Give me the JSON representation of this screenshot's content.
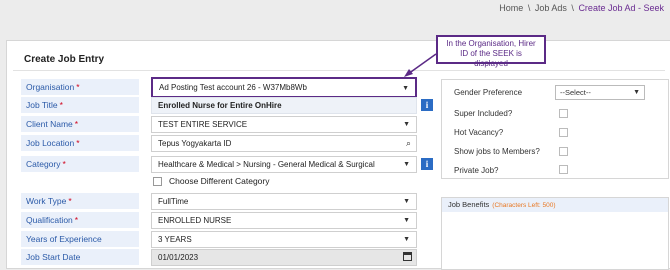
{
  "breadcrumb": {
    "home": "Home",
    "sep": "\\",
    "job_ads": "Job Ads",
    "current": "Create Job Ad - Seek"
  },
  "card": {
    "title": "Create Job Entry"
  },
  "form": {
    "organisation": {
      "label": "Organisation",
      "required": "*",
      "value": "Ad Posting Test account 26 - W37Mb8Wb"
    },
    "job_title": {
      "label": "Job Title",
      "required": "*",
      "value": "Enrolled Nurse for Entire OnHire"
    },
    "client_name": {
      "label": "Client Name",
      "required": "*",
      "value": "TEST ENTIRE SERVICE"
    },
    "job_location": {
      "label": "Job Location",
      "required": "*",
      "value": "Tepus Yogyakarta ID"
    },
    "category": {
      "label": "Category",
      "required": "*",
      "value": "Healthcare & Medical > Nursing - General Medical & Surgical"
    },
    "choose_different_category": "Choose Different Category",
    "work_type": {
      "label": "Work Type",
      "required": "*",
      "value": "FullTime"
    },
    "qualification": {
      "label": "Qualification",
      "required": "*",
      "value": "ENROLLED NURSE"
    },
    "years_experience": {
      "label": "Years of Experience",
      "value": "3 YEARS"
    },
    "job_start_date": {
      "label": "Job Start Date",
      "value": "01/01/2023"
    }
  },
  "right_panel": {
    "gender_preference": {
      "label": "Gender Preference",
      "value": "--Select--"
    },
    "super_included": "Super Included?",
    "hot_vacancy": "Hot Vacancy?",
    "show_jobs": "Show jobs to Members?",
    "private_job": "Private Job?"
  },
  "benefits": {
    "label": "Job Benefits",
    "chars_left": "(Characters Left: 500)"
  },
  "callout": {
    "text": "In the Organisation, Hirer ID of the SEEK is displayed"
  },
  "icons": {
    "info": "i",
    "caret": "▼",
    "search": "⌕"
  },
  "colors": {
    "accent": "#5b2a86",
    "label_bg": "#eaf0fa",
    "label_text": "#2b5aa8",
    "info_blue": "#2b6cc4"
  }
}
